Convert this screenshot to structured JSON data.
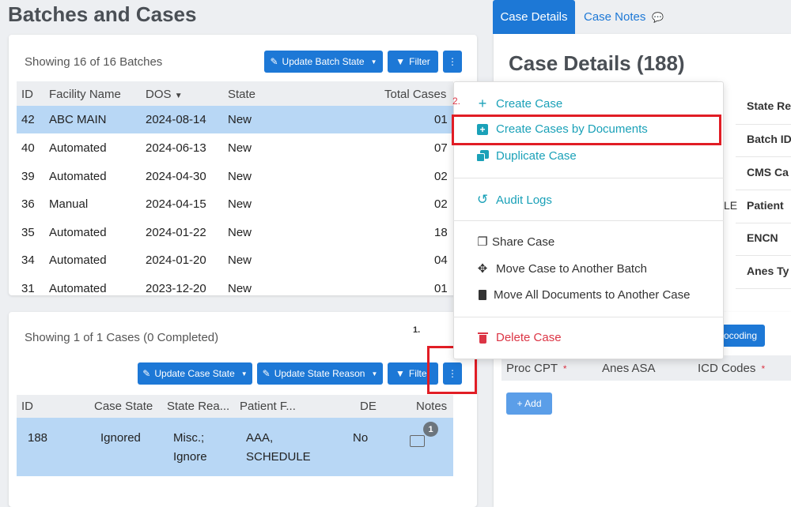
{
  "page_title": "Batches and Cases",
  "tabs": {
    "active": "Case Details",
    "other": "Case Notes"
  },
  "batches": {
    "showing": "Showing 16 of 16 Batches",
    "update_btn": "Update Batch State",
    "filter_btn": "Filter",
    "headers": {
      "id": "ID",
      "facility": "Facility Name",
      "dos": "DOS",
      "state": "State",
      "total": "Total Cases"
    },
    "rows": [
      {
        "id": "42",
        "facility": "ABC MAIN",
        "dos": "2024-08-14",
        "state": "New",
        "total": "01"
      },
      {
        "id": "40",
        "facility": "Automated",
        "dos": "2024-06-13",
        "state": "New",
        "total": "07"
      },
      {
        "id": "39",
        "facility": "Automated",
        "dos": "2024-04-30",
        "state": "New",
        "total": "02"
      },
      {
        "id": "36",
        "facility": "Manual",
        "dos": "2024-04-15",
        "state": "New",
        "total": "02"
      },
      {
        "id": "35",
        "facility": "Automated",
        "dos": "2024-01-22",
        "state": "New",
        "total": "18"
      },
      {
        "id": "34",
        "facility": "Automated",
        "dos": "2024-01-20",
        "state": "New",
        "total": "04"
      },
      {
        "id": "31",
        "facility": "Automated",
        "dos": "2023-12-20",
        "state": "New",
        "total": "01"
      }
    ]
  },
  "cases": {
    "showing": "Showing 1 of 1 Cases (0 Completed)",
    "update_state_btn": "Update Case State",
    "update_reason_btn": "Update State Reason",
    "filter_btn": "Filte",
    "headers": {
      "id": "ID",
      "state": "Case State",
      "reason": "State Rea...",
      "patient": "Patient F...",
      "de": "DE",
      "notes": "Notes"
    },
    "row": {
      "id": "188",
      "state": "Ignored",
      "reason_1": "Misc.;",
      "reason_2": "Ignore",
      "patient_1": "AAA,",
      "patient_2": "SCHEDULE",
      "de": "No",
      "notes_count": "1"
    }
  },
  "case_details": {
    "title": "Case Details (188)",
    "labels": [
      "State Re",
      "Batch ID",
      "CMS Ca",
      "Patient",
      "ENCN",
      "Anes Ty"
    ],
    "patient_suffix": "LE",
    "recoding_btn": "ocoding",
    "proc_headers": {
      "cpt": "Proc CPT",
      "asa": "Anes ASA",
      "icd": "ICD Codes",
      "required": "*"
    },
    "add_btn": "+ Add"
  },
  "menu": {
    "marker": "2.",
    "items": {
      "create_case": "Create Case",
      "create_by_docs": "Create Cases by Documents",
      "duplicate": "Duplicate Case",
      "audit": "Audit Logs",
      "share": "Share Case",
      "move_case": "Move Case to Another Batch",
      "move_docs": "Move All Documents to Another Case",
      "delete": "Delete Case"
    }
  },
  "annotations": {
    "step1": "1."
  },
  "colors": {
    "primary": "#1d78d6",
    "teal": "#1aa1b8",
    "danger": "#dc3545",
    "highlight": "#e11d25",
    "selected_row": "#b8d7f5"
  }
}
